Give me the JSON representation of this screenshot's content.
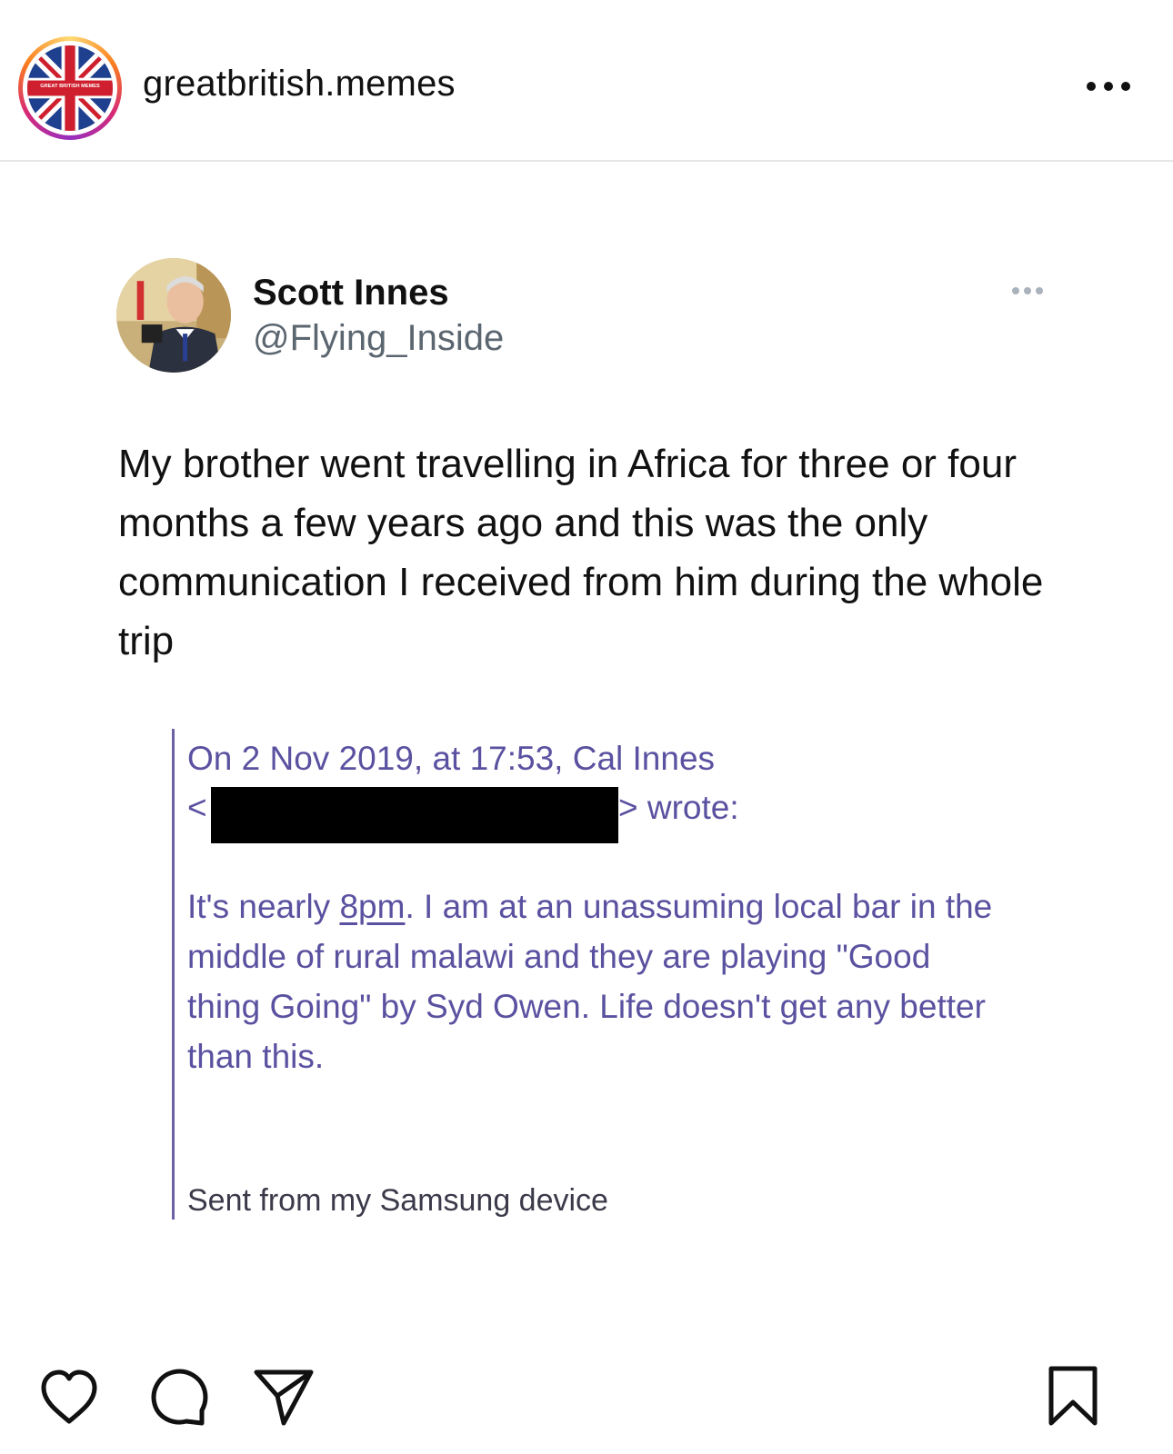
{
  "post": {
    "username": "greatbritish.memes",
    "avatar_icon": "union-jack-logo-icon",
    "avatar_logo_text": "GREAT BRITISH MEMES"
  },
  "tweet": {
    "display_name": "Scott Innes",
    "handle": "@Flying_Inside",
    "text": "My brother went travelling in Africa for three or four months a few years ago and this was the only communication I received from him during the whole trip"
  },
  "email": {
    "header_line1": "On 2 Nov 2019, at 17:53, Cal Innes",
    "header_open": "<",
    "header_close": "> wrote:",
    "body_pre": "It's nearly ",
    "body_link": "8pm",
    "body_post": ". I am at an unassuming local bar in the middle of rural malawi and they are playing \"Good thing Going\" by Syd Owen. Life doesn't get any better than this.",
    "signature": "Sent from my Samsung device"
  },
  "actions": {
    "like_icon": "heart-icon",
    "comment_icon": "comment-icon",
    "share_icon": "send-icon",
    "save_icon": "bookmark-icon"
  },
  "colors": {
    "quote_text": "#5a51a0",
    "quote_bar": "#6b62a6",
    "handle": "#5b6670"
  }
}
